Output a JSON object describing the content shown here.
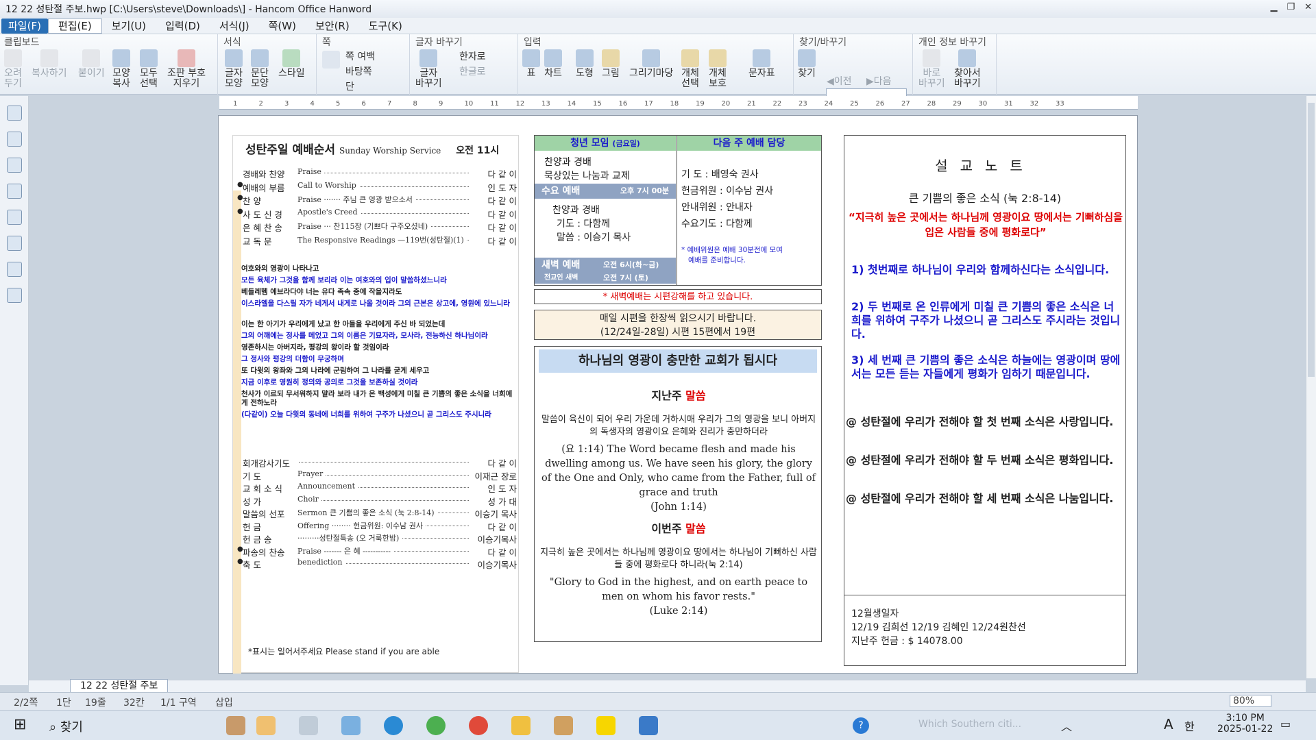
{
  "title": "12    22  성탄절 주보.hwp [C:\\Users\\steve\\Downloads\\] - Hancom Office Hanword",
  "menus": [
    "파일(F)",
    "편집(E)",
    "보기(U)",
    "입력(D)",
    "서식(J)",
    "쪽(W)",
    "보안(R)",
    "도구(K)"
  ],
  "ribbon": {
    "groups": [
      "클립보드",
      "서식",
      "쪽",
      "글자 바꾸기",
      "입력",
      "찾기/바꾸기",
      "개인 정보 바꾸기"
    ],
    "clip": [
      "오려\n두기",
      "복사하기",
      "붙이기",
      "모양\n복사",
      "모두\n선택",
      "조판 부호\n지우기"
    ],
    "fmt": [
      "글자\n모양",
      "문단\n모양",
      "스타일"
    ],
    "page_items": [
      "쪽 여백",
      "바탕쪽",
      "단"
    ],
    "char": [
      "글자\n바꾸기",
      "한자로",
      "한글로"
    ],
    "input": [
      "표",
      "차트",
      "도형",
      "그림",
      "그리기마당",
      "개체\n선택",
      "개체\n보호",
      "문자표"
    ],
    "find": [
      "찾기",
      "이전",
      "다음"
    ],
    "priv": [
      "바로\n바꾸기",
      "찾아서\n바꾸기"
    ]
  },
  "ruler": [
    "1",
    "2",
    "3",
    "4",
    "5",
    "6",
    "7",
    "8",
    "9",
    "10",
    "11",
    "12",
    "13",
    "14",
    "15",
    "16",
    "17",
    "18",
    "19",
    "20",
    "21",
    "22",
    "23",
    "24",
    "25",
    "26",
    "27",
    "28",
    "29",
    "30",
    "31",
    "32",
    "33"
  ],
  "worship": {
    "title": "성탄주일 예배순서",
    "title_en": "Sunday Worship Service",
    "time": "오전 11시",
    "rows": [
      {
        "b": false,
        "label": "경배와 찬양",
        "mid": "Praise",
        "right": "다 같 이"
      },
      {
        "b": true,
        "label": "예배의 부름",
        "mid": "Call to Worship",
        "right": "인 도 자"
      },
      {
        "b": true,
        "label": "찬          양",
        "mid": "Praise ······· 주님 큰 영광 받으소서",
        "right": "다 같 이"
      },
      {
        "b": true,
        "label": "사 도 신 경",
        "mid": "Apostle's Creed",
        "right": "다 같 이"
      },
      {
        "b": false,
        "label": "은 혜 찬 송",
        "mid": "Praise ··· 찬115장 (기쁘다 구주오셨네)",
        "right": "다 같 이"
      },
      {
        "b": false,
        "label": "교      독      문",
        "mid": "The Responsive Readings —119번(성탄절)(1)",
        "right": "다 같 이"
      }
    ],
    "verses": [
      {
        "c": "k",
        "t": "여호와의 영광이 나타나고"
      },
      {
        "c": "b",
        "t": "모든 육체가 그것을 함께 보리라 이는 여호와의 입이 말씀하셨느니라"
      },
      {
        "c": "k",
        "t": "베들레헴 에브라다야 너는 유다 족속 중에 작을지라도"
      },
      {
        "c": "b",
        "t": "이스라엘을 다스릴 자가 네게서 내게로 나올 것이라 그의 근본은 상고에, 영원에 있느니라"
      },
      {
        "c": "k",
        "t": "이는 한 아기가 우리에게 났고 한 아들을 우리에게 주신 바 되었는데"
      },
      {
        "c": "b",
        "t": "그의 어깨에는 정사를 메었고 그의 이름은 기묘자라, 모사라, 전능하신 하나님이라"
      },
      {
        "c": "k",
        "t": "영존하시는 아버지라, 평강의 왕이라 할 것임이라"
      },
      {
        "c": "b",
        "t": "그 정사와 평강의 더함이 무궁하며"
      },
      {
        "c": "k",
        "t": "또 다윗의 왕좌와 그의 나라에 군림하여 그 나라를 굳게 세우고"
      },
      {
        "c": "b",
        "t": "지금 이후로 영원히 정의와 공의로 그것을 보존하실 것이라"
      },
      {
        "c": "k",
        "t": "천사가 이르되 무서워하지 말라 보라 내가 온 백성에게 미칠 큰 기쁨의 좋은 소식을 너희에게 전하노라"
      },
      {
        "c": "b",
        "t": "(다같이) 오늘 다윗의 동네에 너희를 위하여 구주가 나셨으니 곧 그리스도 주시니라"
      }
    ],
    "rows2": [
      {
        "b": false,
        "label": "회개감사기도",
        "mid": "",
        "right": "다 같 이"
      },
      {
        "b": false,
        "label": "기          도",
        "mid": "Prayer",
        "right": "이재근 장로"
      },
      {
        "b": false,
        "label": "교 회 소 식",
        "mid": "Announcement",
        "right": "인 도 자"
      },
      {
        "b": false,
        "label": "성          가",
        "mid": "Choir",
        "right": "성 가 대"
      },
      {
        "b": false,
        "label": "말씀의 선포",
        "mid": "Sermon    큰 기쁨의 좋은 소식 (눅 2:8-14)",
        "right": "이승기 목사"
      },
      {
        "b": false,
        "label": "헌          금",
        "mid": "Offering ········ 헌금위원: 이수남 권사",
        "right": "다 같 이"
      },
      {
        "b": false,
        "label": "헌   금   송",
        "mid": "·········성탄절특송 (오 거룩한밤)",
        "right": "이승기목사"
      },
      {
        "b": true,
        "label": "파송의 찬송",
        "mid": "Praise -------  은 혜  -----------",
        "right": "다 같 이"
      },
      {
        "b": true,
        "label": "축          도",
        "mid": "benediction",
        "right": "이승기목사"
      }
    ],
    "note": "*표시는 일어서주세요 Please stand if you are able"
  },
  "youth": {
    "hd": "청년 모임",
    "hd_sub": "(금요일)",
    "items": [
      "찬양과 경배",
      "묵상있는 나눔과 교제"
    ]
  },
  "wed": {
    "hd": "수요 예배",
    "time": "오후 7시 00분",
    "items": [
      "찬양과 경배",
      "기도 : 다함께",
      "말씀 : 이승기 목사"
    ]
  },
  "dawn": {
    "hd": "새벽 예배",
    "hd2": "전교인 새벽",
    "time1": "오전 6시(화~금)",
    "time2": "오전 7시 (토)"
  },
  "next": {
    "hd": "다음 주 예배 담당",
    "items": [
      "기      도 : 배영숙 권사",
      "헌금위원 : 이수남 권사",
      "안내위원 : 안내자",
      "수요기도 : 다함께"
    ],
    "note": "* 예배위원은 예배 30분전에 모여\n   예배를 준비합니다."
  },
  "redline": "* 새벽예배는 시편강해를 하고 있습니다.",
  "reading": [
    "매일 시편을 한장씩 읽으시기 바랍니다.",
    "(12/24일-28일) 시편 15편에서 19편"
  ],
  "glory": {
    "title": "하나님의 영광이 충만한 교회가 됩시다",
    "last_a": "지난주 ",
    "last_b": "말씀",
    "last_ko": "말씀이 육신이 되어 우리 가운데 거하시매 우리가 그의 영광을 보니 아버지의 독생자의 영광이요 은혜와 진리가 충만하더라",
    "last_en": "(요 1:14) The Word became flesh and made his dwelling among us. We have seen his glory, the glory of the One and Only, who came from the Father, full of grace and truth",
    "last_ref": "(John 1:14)",
    "this_a": "이번주 ",
    "this_b": "말씀",
    "this_ko": "지극히 높은 곳에서는 하나님께 영광이요 땅에서는 하나님이 기뻐하신 사람들 중에 평화로다 하니라(눅 2:14)",
    "this_en": "\"Glory to God in the highest, and on earth peace to men on whom his favor rests.\"",
    "this_ref": "(Luke 2:14)"
  },
  "sermon": {
    "title": "설교노트",
    "sub": "큰 기쁨의 좋은 소식 (눅 2:8-14)",
    "quote": "“지극히 높은 곳에서는 하나님께 영광이요 땅에서는 기뻐하심을 입은 사람들 중에 평화로다”",
    "points": [
      {
        "n": "1)",
        "t": "첫번째로 하나님이 우리와 함께하신다는 소식입니다."
      },
      {
        "n": "2)",
        "t": "두 번째로 온 인류에게 미칠 큰 기쁨의 좋은 소식은 너희를 위하여 구주가 나셨으니 곧 그리스도 주시라는 것입니다."
      },
      {
        "n": "3)",
        "t": "세 번째 큰 기쁨의 좋은 소식은 하늘에는 영광이며 땅에서는 모든 듣는 자들에게 평화가 임하기 때문입니다."
      }
    ],
    "ats": [
      "@ 성탄절에 우리가 전해야 할 첫 번째 소식은 사랑입니다.",
      "@ 성탄절에 우리가 전해야 할 두 번째 소식은 평화입니다.",
      "@ 성탄절에 우리가 전해야 할 세 번째 소식은 나눔입니다."
    ],
    "bday_title": "12월생일자",
    "bday": "12/19 김희선 12/19 김혜인 12/24원찬선",
    "offering": "지난주 헌금 : $ 14078.00"
  },
  "tab": "12    22  성탄절 주보",
  "status": {
    "page": "2/2쪽",
    "col": "1단",
    "line": "19줄",
    "char": "32칸",
    "sect": "1/1 구역",
    "mode": "삽입",
    "zoom": "80%"
  },
  "taskbar": {
    "search": "찾기",
    "weather": "Which Southern citi...",
    "time": "3:10 PM",
    "date": "2025-01-22",
    "lang": "한",
    "ime": "A"
  }
}
